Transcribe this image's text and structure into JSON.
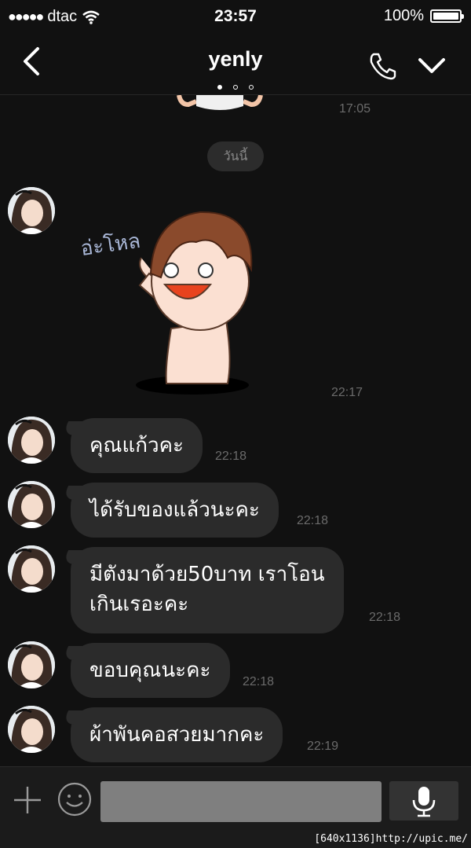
{
  "status_bar": {
    "signal": "●●●●●",
    "carrier": "dtac",
    "time": "23:57",
    "battery": "100%"
  },
  "header": {
    "title": "yenly",
    "icons": [
      "back-chevron-icon",
      "phone-icon",
      "chevron-down-icon"
    ]
  },
  "chat": {
    "prev_sticker_time": "17:05",
    "date_divider": "วันนี้",
    "sticker": {
      "text": "อ่ะโหล",
      "time": "22:17"
    },
    "messages": [
      {
        "text": "คุณแก้วคะ",
        "time": "22:18"
      },
      {
        "text": "ได้รับของแล้วนะคะ",
        "time": "22:18"
      },
      {
        "text": "มีตังมาด้วย50บาท เราโอน",
        "text2": "เกินเรอะคะ",
        "time": "22:18"
      },
      {
        "text": "ขอบคุณนะคะ",
        "time": "22:18"
      },
      {
        "text": "ผ้าพันคอสวยมากคะ",
        "time": "22:19"
      }
    ]
  },
  "input_bar": {
    "placeholder": "",
    "icons": [
      "plus-icon",
      "smiley-icon",
      "microphone-icon"
    ]
  },
  "watermark": "[640x1136]http://upic.me/",
  "colors": {
    "background": "#111111",
    "bubble": "#2b2b2b",
    "timestamp": "#6b6b6b"
  }
}
